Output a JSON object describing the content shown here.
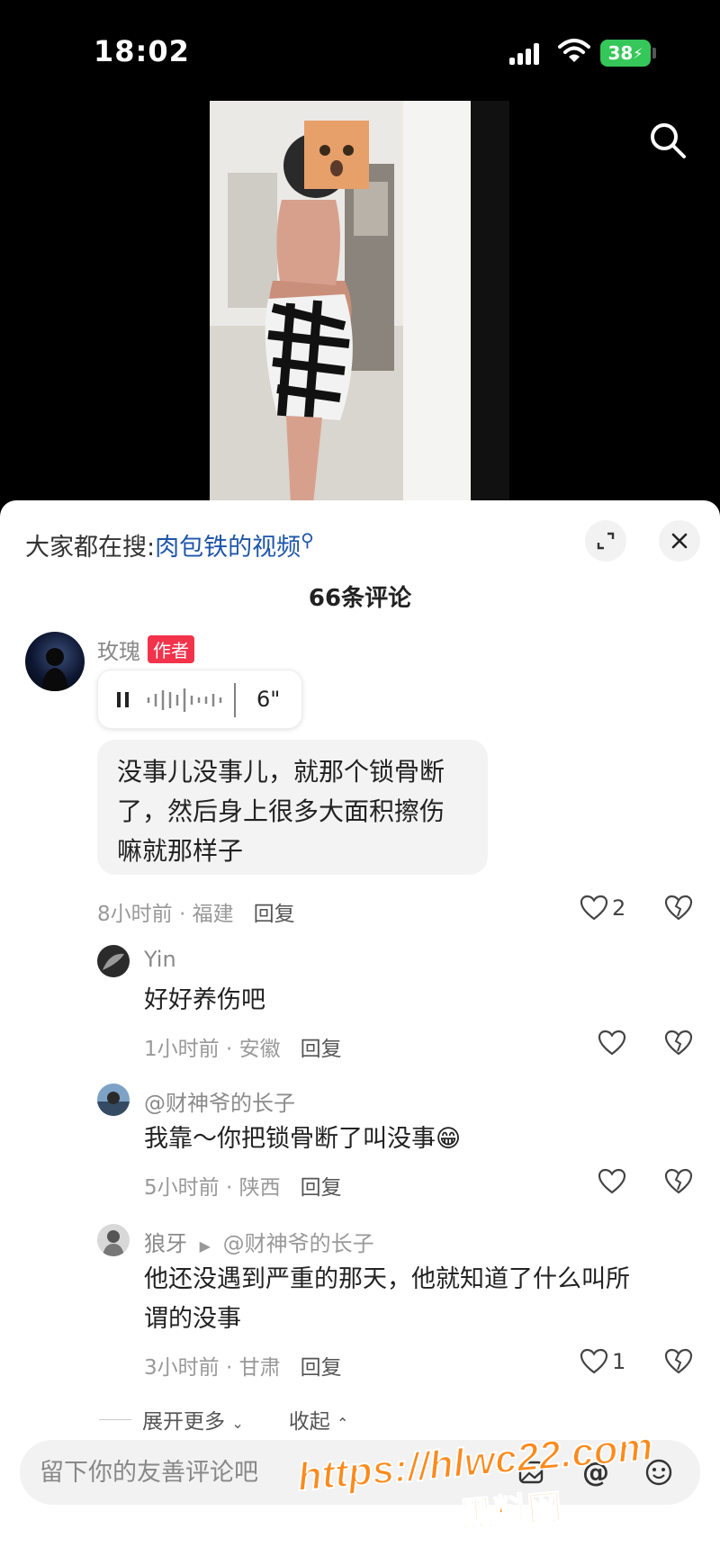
{
  "status_bar": {
    "time": "18:02",
    "battery": "38"
  },
  "sheet": {
    "search_prefix": "大家都在搜:",
    "search_keyword": "肉包铁的视频",
    "comment_count": "66条评论"
  },
  "comments": {
    "main": {
      "user": "玫瑰",
      "badge": "作者",
      "voice_duration": "6\"",
      "text": "没事儿没事儿，就那个锁骨断了，然后身上很多大面积擦伤嘛就那样子",
      "time_loc": "8小时前 · 福建",
      "reply": "回复",
      "likes": "2"
    },
    "replies": [
      {
        "user": "Yin",
        "text": "好好养伤吧",
        "time_loc": "1小时前 · 安徽",
        "reply": "回复",
        "likes": ""
      },
      {
        "user": "@财神爷的长子",
        "text": "我靠～你把锁骨断了叫没事😁",
        "time_loc": "5小时前 · 陕西",
        "reply": "回复",
        "likes": ""
      },
      {
        "user": "狼牙",
        "reply_to": "@财神爷的长子",
        "text_line1": "他还没遇到严重的那天，他就知道了什么叫所",
        "text_line2": "谓的没事",
        "time_loc": "3小时前 · 甘肃",
        "reply": "回复",
        "likes": "1"
      }
    ]
  },
  "expand": {
    "more": "展开更多",
    "collapse": "收起"
  },
  "input": {
    "placeholder": "留下你的友善评论吧"
  },
  "watermark": {
    "url": "https://hlwc22.com",
    "site": "黑料网"
  },
  "colors": {
    "accent_link": "#1f56a8",
    "author_badge": "#f2334b",
    "battery": "#35c759",
    "watermark": "#ff8a1c"
  },
  "icons": [
    "search-icon",
    "expand-icon",
    "close-icon",
    "pause-icon",
    "heart-icon",
    "broken-heart-icon",
    "image-icon",
    "at-icon",
    "emoji-icon"
  ]
}
